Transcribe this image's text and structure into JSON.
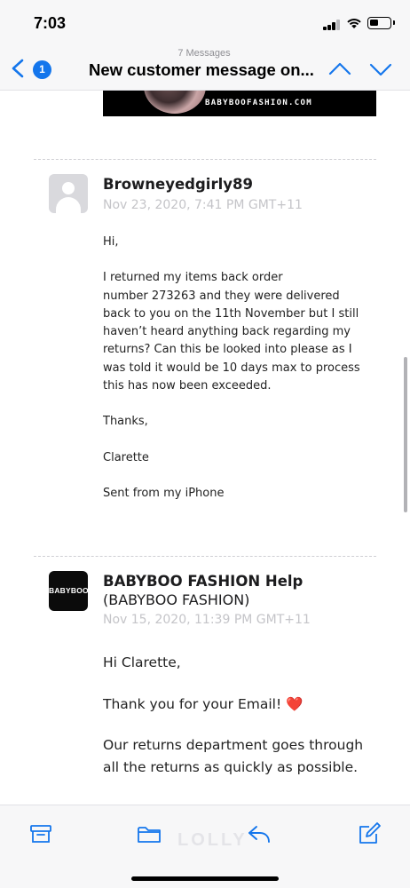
{
  "status_bar": {
    "time": "7:03"
  },
  "header": {
    "unread_count": "1",
    "message_count": "7 Messages",
    "title": "New customer message on..."
  },
  "banner": {
    "brand": "BABYBOOFASHION.COM"
  },
  "messages": [
    {
      "sender": "Browneyedgirly89",
      "date": "Nov 23, 2020, 7:41 PM GMT+11",
      "paragraphs": [
        "Hi,",
        "I returned my items back order\nnumber 273263 and they were delivered\nback to you on the 11th November but I still\nhaven’t heard anything back regarding my\nreturns? Can this be looked into please as I\nwas told it would be 10 days max to process\nthis has now been exceeded.",
        "Thanks,",
        "Clarette",
        "Sent from my iPhone"
      ]
    },
    {
      "avatar_text": "BABYBOO",
      "sender": "BABYBOO FASHION Help",
      "sender_sub": "(BABYBOO FASHION)",
      "date": "Nov 15, 2020, 11:39 PM GMT+11",
      "paragraphs": [
        "Hi Clarette,",
        "Thank you for your Email! ❤️",
        "Our returns department goes through\nall the returns as quickly as possible."
      ]
    }
  ],
  "watermark": "LOLLY",
  "colors": {
    "accent": "#1476ec",
    "date_text": "#c4c4c8",
    "bar_background": "#f7f7f8"
  },
  "icons": {
    "back": "chevron-left-icon",
    "previous": "chevron-up-icon",
    "next": "chevron-down-icon",
    "archive": "archive-icon",
    "move": "folder-icon",
    "reply": "reply-icon",
    "compose": "compose-icon"
  }
}
